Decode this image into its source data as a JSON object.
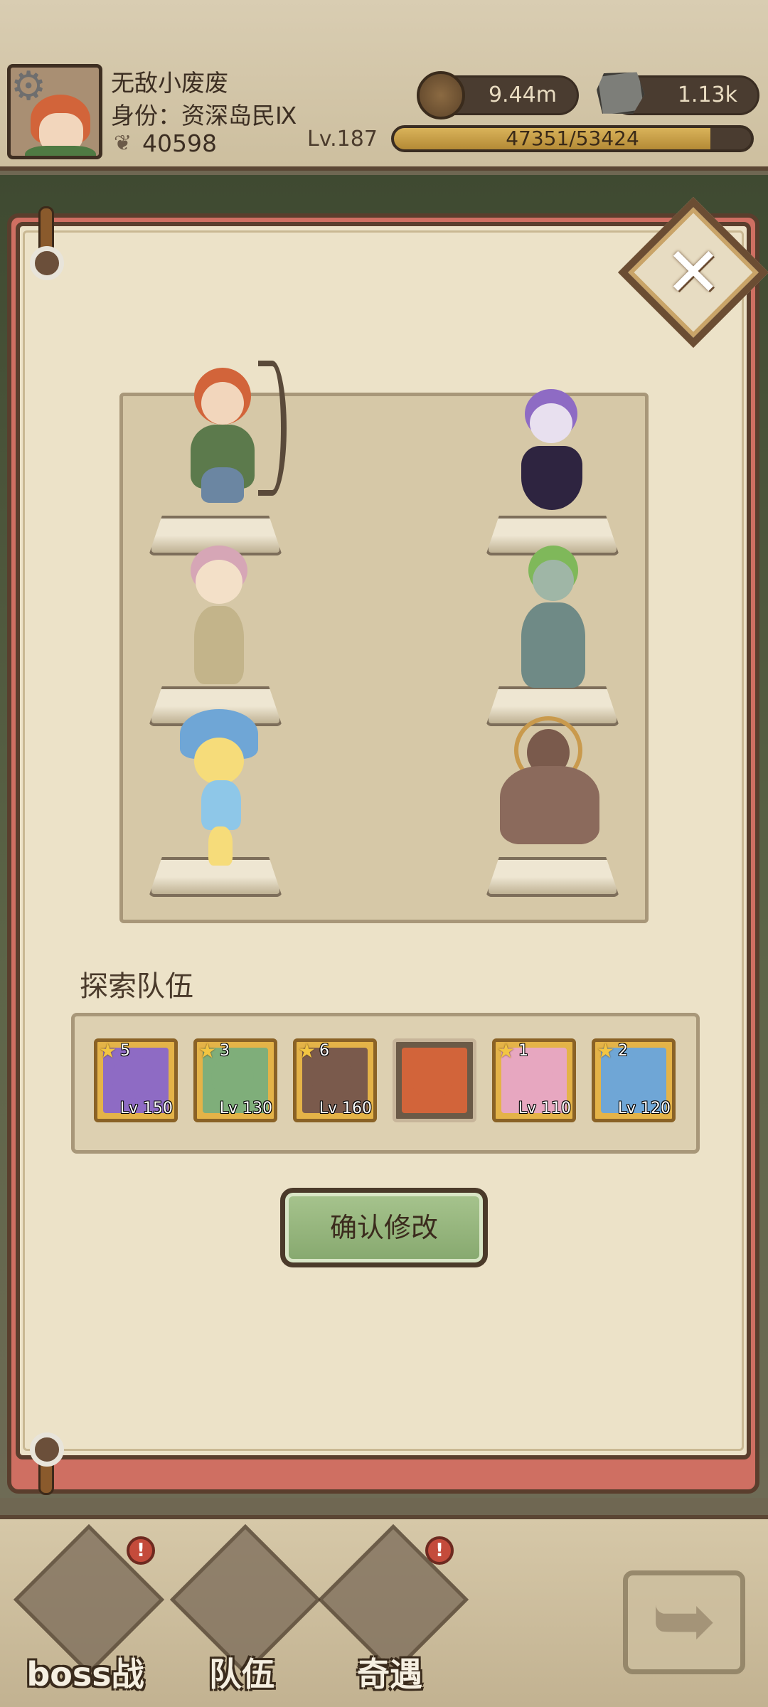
{
  "player": {
    "name": "无敌小废废",
    "title": "身份：资深岛民Ⅸ",
    "power": "40598",
    "level": "Lv.187",
    "exp": "47351/53424",
    "exp_fraction": 0.886
  },
  "resources": {
    "coins": "9.44m",
    "stones": "1.13k"
  },
  "team": {
    "label": "探索队伍",
    "cards": [
      {
        "count": "5",
        "level": "Lv 150",
        "color": "#8e6bc4"
      },
      {
        "count": "3",
        "level": "Lv 130",
        "color": "#7fae7a"
      },
      {
        "count": "6",
        "level": "Lv 160",
        "color": "#7a5a4c"
      },
      {
        "count": "",
        "level": "",
        "color": "#d2643a"
      },
      {
        "count": "1",
        "level": "Lv 110",
        "color": "#e7a7c0"
      },
      {
        "count": "2",
        "level": "Lv 120",
        "color": "#6fa6d6"
      }
    ]
  },
  "confirm_label": "确认修改",
  "nav": {
    "boss": "boss战",
    "team": "队伍",
    "adventure": "奇遇",
    "badge": "!"
  },
  "colors": {
    "panel": "#ece2c8",
    "border": "#5a3e2d",
    "confirm": "#98b67e"
  },
  "icons": [
    "gear-icon",
    "coin-icon",
    "stone-icon",
    "close-icon",
    "back-arrow-icon",
    "star-icon"
  ]
}
